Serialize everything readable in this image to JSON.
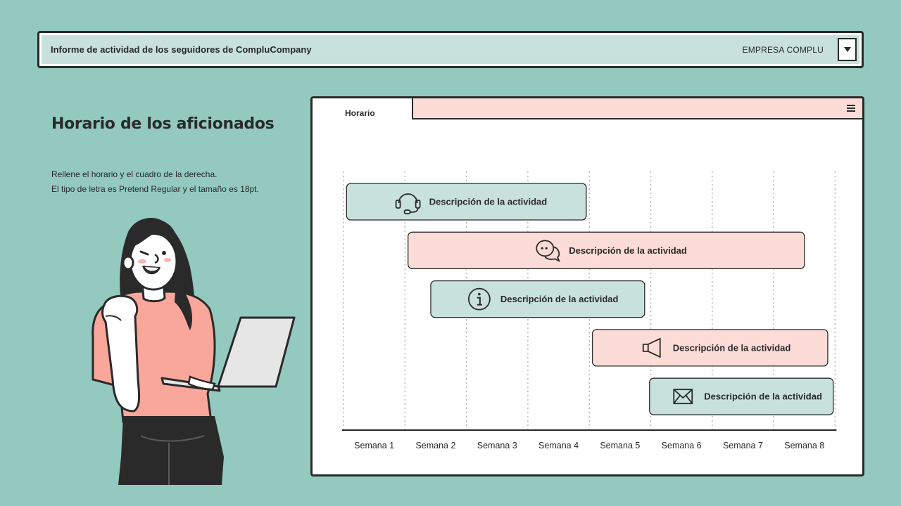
{
  "header": {
    "title": "Informe de actividad de los seguidores de CompluCompany",
    "company": "EMPRESA COMPLU"
  },
  "left": {
    "heading": "Horario de los aficionados",
    "desc_line1": "Rellene el horario y el cuadro de la derecha.",
    "desc_line2": "El tipo de letra es Pretend Regular y el tamaño es 18pt."
  },
  "window": {
    "tab_label": "Horario"
  },
  "colors": {
    "background": "#93c9bf",
    "mint": "#c9e1dc",
    "pink": "#fcdcd6",
    "ink": "#2a2a2a"
  },
  "chart_data": {
    "type": "gantt",
    "categories": [
      "Semana 1",
      "Semana 2",
      "Semana 3",
      "Semana 4",
      "Semana 5",
      "Semana 6",
      "Semana 7",
      "Semana 8"
    ],
    "tasks": [
      {
        "label": "Descripción de la actividad",
        "start": 0.05,
        "end": 3.95,
        "icon": "headset-icon",
        "color": "mint"
      },
      {
        "label": "Descripción de la actividad",
        "start": 1.05,
        "end": 7.5,
        "icon": "chat-bubbles-icon",
        "color": "pink"
      },
      {
        "label": "Descripción de la actividad",
        "start": 1.42,
        "end": 4.9,
        "icon": "info-icon",
        "color": "mint"
      },
      {
        "label": "Descripción de la actividad",
        "start": 4.05,
        "end": 7.88,
        "icon": "megaphone-icon",
        "color": "pink"
      },
      {
        "label": "Descripción de la actividad",
        "start": 4.98,
        "end": 7.97,
        "icon": "envelope-icon",
        "color": "mint"
      }
    ]
  }
}
